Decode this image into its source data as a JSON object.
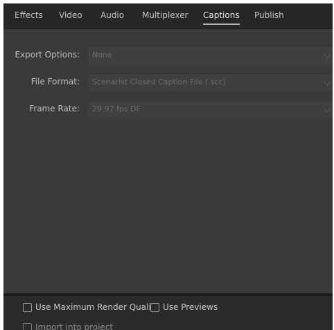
{
  "tabs": [
    {
      "label": "Effects"
    },
    {
      "label": "Video"
    },
    {
      "label": "Audio"
    },
    {
      "label": "Multiplexer"
    },
    {
      "label": "Captions",
      "active": true
    },
    {
      "label": "Publish"
    }
  ],
  "captions": {
    "export_options": {
      "label": "Export Options:",
      "value": "None"
    },
    "file_format": {
      "label": "File Format:",
      "value": "Scenarist Closed Caption File (.scc)"
    },
    "frame_rate": {
      "label": "Frame Rate:",
      "value": "29.97 fps DF"
    }
  },
  "footer": {
    "max_render_quality": {
      "label": "Use Maximum Render Quality",
      "checked": false
    },
    "use_previews": {
      "label": "Use Previews",
      "checked": false
    },
    "import_into_project": {
      "label": "Import into project",
      "checked": false
    }
  },
  "colors": {
    "window_bg": "#323232",
    "tabbar_bg": "#262626",
    "panel_bg": "#3a3a3a",
    "field_bg": "#3f3f3f",
    "footer_bg": "#2b2b2b",
    "text": "#c4c4c4",
    "disabled_text": "#6c6c6c"
  }
}
